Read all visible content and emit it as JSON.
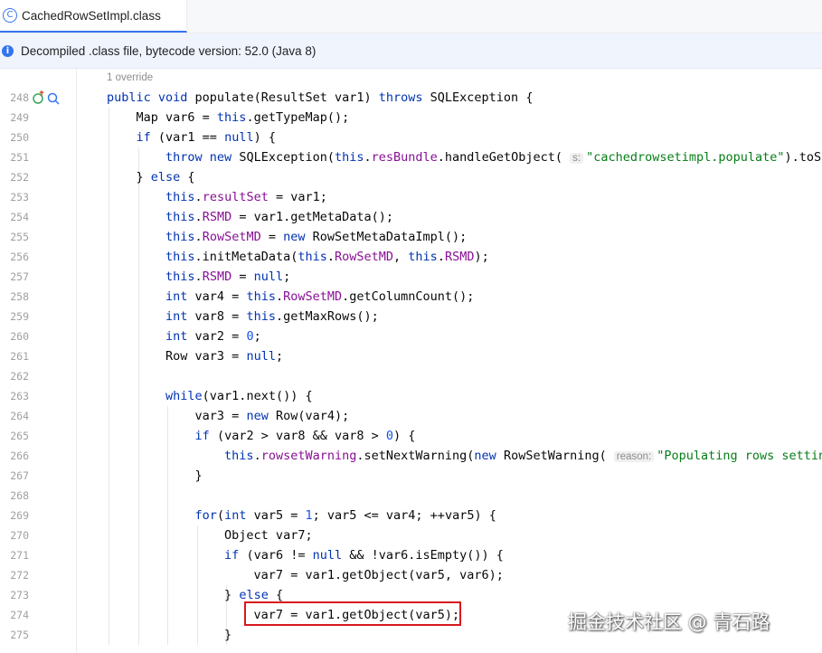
{
  "tab": {
    "icon": "class-file-icon",
    "label": "CachedRowSetImpl.class"
  },
  "banner": {
    "icon": "info-icon",
    "text": "Decompiled .class file, bytecode version: 52.0 (Java 8)"
  },
  "editor": {
    "override_hint": "1 override",
    "gutter_icons": [
      "override-icon",
      "find-usages-icon"
    ],
    "lines": [
      {
        "n": "248",
        "segs": [
          [
            "kw",
            "public "
          ],
          [
            "kw",
            "void "
          ],
          [
            "t",
            "populate(ResultSet var1) "
          ],
          [
            "kw",
            "throws "
          ],
          [
            "t",
            "SQLException {"
          ]
        ]
      },
      {
        "n": "249",
        "segs": [
          [
            "t",
            "    Map var6 = "
          ],
          [
            "kw",
            "this"
          ],
          [
            "t",
            ".getTypeMap();"
          ]
        ]
      },
      {
        "n": "250",
        "segs": [
          [
            "t",
            "    "
          ],
          [
            "kw",
            "if "
          ],
          [
            "t",
            "(var1 == "
          ],
          [
            "kw",
            "null"
          ],
          [
            "t",
            ") {"
          ]
        ]
      },
      {
        "n": "251",
        "segs": [
          [
            "t",
            "        "
          ],
          [
            "kw",
            "throw new "
          ],
          [
            "t",
            "SQLException("
          ],
          [
            "kw",
            "this"
          ],
          [
            "t",
            "."
          ],
          [
            "fld",
            "resBundle"
          ],
          [
            "t",
            ".handleGetObject( "
          ],
          [
            "hint",
            "s:"
          ],
          [
            "str",
            "\"cachedrowsetimpl.populate\""
          ],
          [
            "t",
            ").toStr"
          ]
        ]
      },
      {
        "n": "252",
        "segs": [
          [
            "t",
            "    } "
          ],
          [
            "kw",
            "else "
          ],
          [
            "t",
            "{"
          ]
        ]
      },
      {
        "n": "253",
        "segs": [
          [
            "t",
            "        "
          ],
          [
            "kw",
            "this"
          ],
          [
            "t",
            "."
          ],
          [
            "fld",
            "resultSet"
          ],
          [
            "t",
            " = var1;"
          ]
        ]
      },
      {
        "n": "254",
        "segs": [
          [
            "t",
            "        "
          ],
          [
            "kw",
            "this"
          ],
          [
            "t",
            "."
          ],
          [
            "fld",
            "RSMD"
          ],
          [
            "t",
            " = var1.getMetaData();"
          ]
        ]
      },
      {
        "n": "255",
        "segs": [
          [
            "t",
            "        "
          ],
          [
            "kw",
            "this"
          ],
          [
            "t",
            "."
          ],
          [
            "fld",
            "RowSetMD"
          ],
          [
            "t",
            " = "
          ],
          [
            "kw",
            "new "
          ],
          [
            "t",
            "RowSetMetaDataImpl();"
          ]
        ]
      },
      {
        "n": "256",
        "segs": [
          [
            "t",
            "        "
          ],
          [
            "kw",
            "this"
          ],
          [
            "t",
            ".initMetaData("
          ],
          [
            "kw",
            "this"
          ],
          [
            "t",
            "."
          ],
          [
            "fld",
            "RowSetMD"
          ],
          [
            "t",
            ", "
          ],
          [
            "kw",
            "this"
          ],
          [
            "t",
            "."
          ],
          [
            "fld",
            "RSMD"
          ],
          [
            "t",
            ");"
          ]
        ]
      },
      {
        "n": "257",
        "segs": [
          [
            "t",
            "        "
          ],
          [
            "kw",
            "this"
          ],
          [
            "t",
            "."
          ],
          [
            "fld",
            "RSMD"
          ],
          [
            "t",
            " = "
          ],
          [
            "kw",
            "null"
          ],
          [
            "t",
            ";"
          ]
        ]
      },
      {
        "n": "258",
        "segs": [
          [
            "t",
            "        "
          ],
          [
            "kw",
            "int "
          ],
          [
            "t",
            "var4 = "
          ],
          [
            "kw",
            "this"
          ],
          [
            "t",
            "."
          ],
          [
            "fld",
            "RowSetMD"
          ],
          [
            "t",
            ".getColumnCount();"
          ]
        ]
      },
      {
        "n": "259",
        "segs": [
          [
            "t",
            "        "
          ],
          [
            "kw",
            "int "
          ],
          [
            "t",
            "var8 = "
          ],
          [
            "kw",
            "this"
          ],
          [
            "t",
            ".getMaxRows();"
          ]
        ]
      },
      {
        "n": "260",
        "segs": [
          [
            "t",
            "        "
          ],
          [
            "kw",
            "int "
          ],
          [
            "t",
            "var2 = "
          ],
          [
            "num",
            "0"
          ],
          [
            "t",
            ";"
          ]
        ]
      },
      {
        "n": "261",
        "segs": [
          [
            "t",
            "        Row var3 = "
          ],
          [
            "kw",
            "null"
          ],
          [
            "t",
            ";"
          ]
        ]
      },
      {
        "n": "262",
        "segs": []
      },
      {
        "n": "263",
        "segs": [
          [
            "t",
            "        "
          ],
          [
            "kw",
            "while"
          ],
          [
            "t",
            "(var1.next()) {"
          ]
        ]
      },
      {
        "n": "264",
        "segs": [
          [
            "t",
            "            var3 = "
          ],
          [
            "kw",
            "new "
          ],
          [
            "t",
            "Row(var4);"
          ]
        ]
      },
      {
        "n": "265",
        "segs": [
          [
            "t",
            "            "
          ],
          [
            "kw",
            "if "
          ],
          [
            "t",
            "(var2 > var8 && var8 > "
          ],
          [
            "num",
            "0"
          ],
          [
            "t",
            ") {"
          ]
        ]
      },
      {
        "n": "266",
        "segs": [
          [
            "t",
            "                "
          ],
          [
            "kw",
            "this"
          ],
          [
            "t",
            "."
          ],
          [
            "fld",
            "rowsetWarning"
          ],
          [
            "t",
            ".setNextWarning("
          ],
          [
            "kw",
            "new "
          ],
          [
            "t",
            "RowSetWarning( "
          ],
          [
            "hint",
            "reason:"
          ],
          [
            "str",
            "\"Populating rows setting"
          ]
        ]
      },
      {
        "n": "267",
        "segs": [
          [
            "t",
            "            }"
          ]
        ]
      },
      {
        "n": "268",
        "segs": []
      },
      {
        "n": "269",
        "segs": [
          [
            "t",
            "            "
          ],
          [
            "kw",
            "for"
          ],
          [
            "t",
            "("
          ],
          [
            "kw",
            "int "
          ],
          [
            "t",
            "var5 = "
          ],
          [
            "num",
            "1"
          ],
          [
            "t",
            "; var5 <= var4; ++var5) {"
          ]
        ]
      },
      {
        "n": "270",
        "segs": [
          [
            "t",
            "                Object var7;"
          ]
        ]
      },
      {
        "n": "271",
        "segs": [
          [
            "t",
            "                "
          ],
          [
            "kw",
            "if "
          ],
          [
            "t",
            "(var6 != "
          ],
          [
            "kw",
            "null "
          ],
          [
            "t",
            "&& !var6.isEmpty()) {"
          ]
        ]
      },
      {
        "n": "272",
        "segs": [
          [
            "t",
            "                    var7 = var1.getObject(var5, var6);"
          ]
        ]
      },
      {
        "n": "273",
        "segs": [
          [
            "t",
            "                } "
          ],
          [
            "kw",
            "else "
          ],
          [
            "t",
            "{"
          ]
        ]
      },
      {
        "n": "274",
        "segs": [
          [
            "t",
            "                    var7 = var1.getObject(var5);"
          ]
        ]
      },
      {
        "n": "275",
        "segs": [
          [
            "t",
            "                }"
          ]
        ]
      }
    ]
  },
  "watermark": "掘金技术社区 @ 青石路"
}
